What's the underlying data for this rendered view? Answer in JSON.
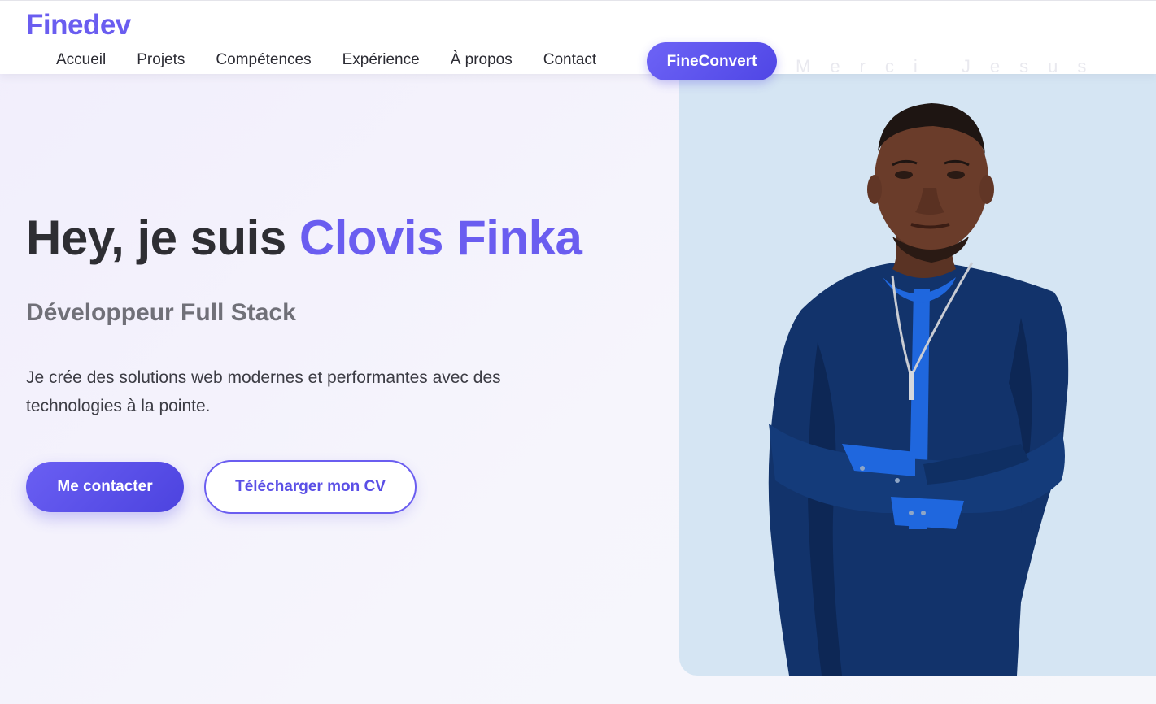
{
  "header": {
    "logo": "Finedev",
    "nav": [
      "Accueil",
      "Projets",
      "Compétences",
      "Expérience",
      "À propos",
      "Contact"
    ],
    "cta": "FineConvert",
    "faint_text": "Merci Jesus"
  },
  "hero": {
    "title_prefix": "Hey, je suis ",
    "title_name": "Clovis Finka",
    "subtitle": "Développeur Full Stack",
    "description": "Je crée des solutions web modernes et performantes avec des technologies à la pointe.",
    "primary_button": "Me contacter",
    "secondary_button": "Télécharger mon CV"
  },
  "colors": {
    "accent": "#6a5df0",
    "photo_background": "#d5e5f3"
  }
}
